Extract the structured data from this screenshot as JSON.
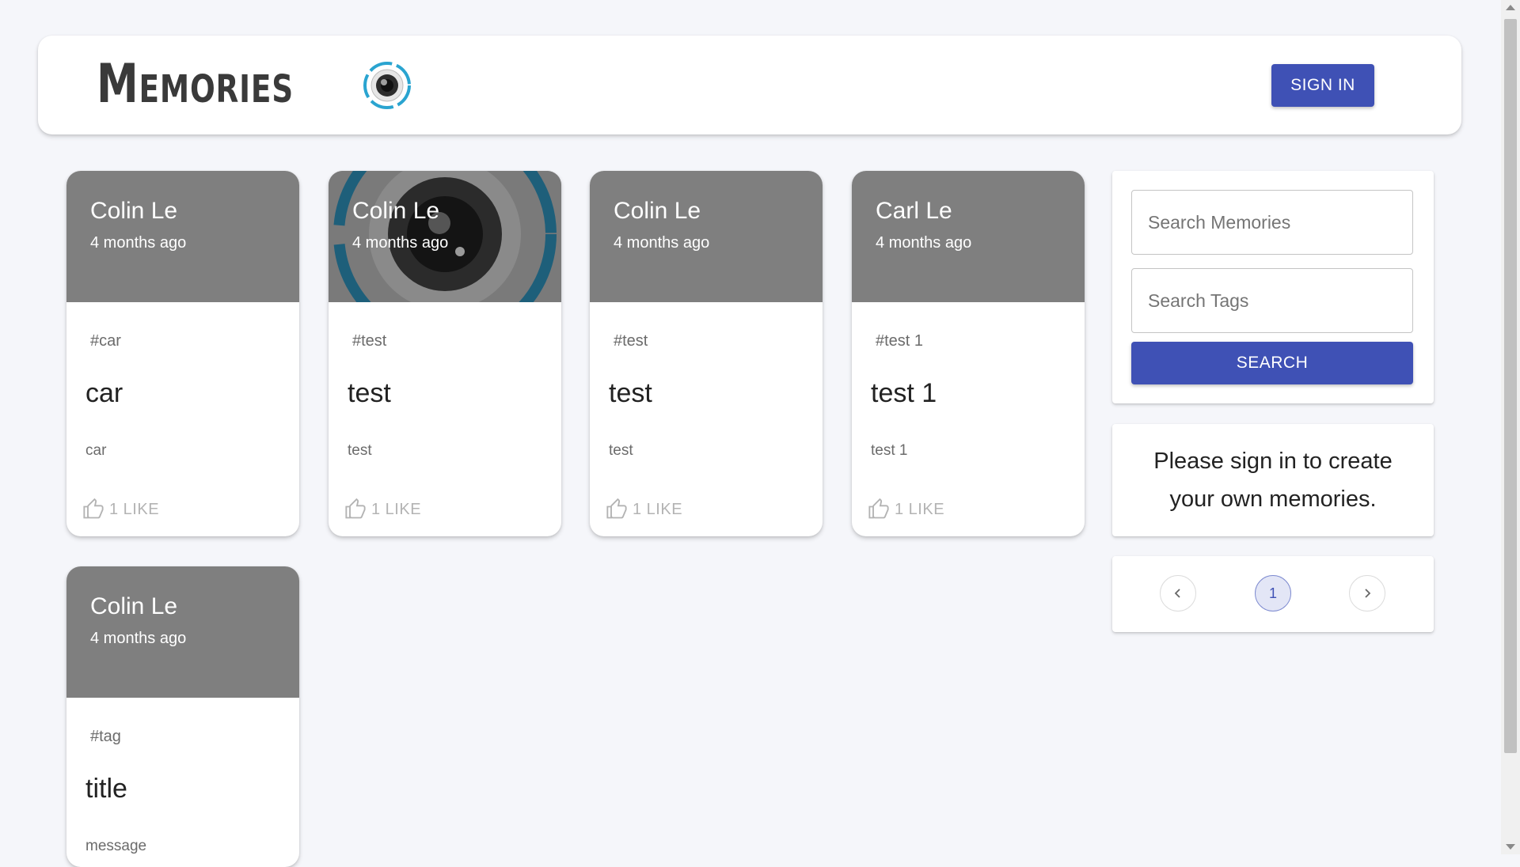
{
  "header": {
    "brand": "Memories",
    "signin_label": "SIGN IN"
  },
  "posts": [
    {
      "author": "Colin Le",
      "time": "4 months ago",
      "tags": "#car",
      "title": "car",
      "message": "car",
      "likes": "1 LIKE",
      "has_image": false
    },
    {
      "author": "Colin Le",
      "time": "4 months ago",
      "tags": "#test",
      "title": "test",
      "message": "test",
      "likes": "1 LIKE",
      "has_image": true
    },
    {
      "author": "Colin Le",
      "time": "4 months ago",
      "tags": "#test",
      "title": "test",
      "message": "test",
      "likes": "1 LIKE",
      "has_image": false
    },
    {
      "author": "Carl Le",
      "time": "4 months ago",
      "tags": "#test 1",
      "title": "test 1",
      "message": "test 1",
      "likes": "1 LIKE",
      "has_image": false
    },
    {
      "author": "Colin Le",
      "time": "4 months ago",
      "tags": "#tag",
      "title": "title",
      "message": "message",
      "likes": "",
      "has_image": false
    }
  ],
  "search": {
    "memories_placeholder": "Search Memories",
    "tags_placeholder": "Search Tags",
    "button_label": "SEARCH"
  },
  "signin_prompt": "Please sign in to create your own memories.",
  "pagination": {
    "prev_icon": "chevron-left-icon",
    "current_page": "1",
    "next_icon": "chevron-right-icon"
  },
  "icons": {
    "logo": "camera-lens-logo",
    "like": "thumb-up-icon"
  },
  "colors": {
    "primary": "#3f51b5",
    "card_header": "#7f7f7f",
    "background": "#f5f6fa",
    "logo_accent": "#2aa4d0"
  }
}
